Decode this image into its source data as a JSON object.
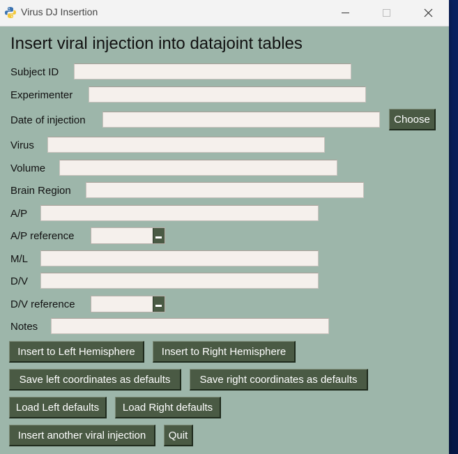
{
  "window": {
    "title": "Virus DJ Insertion",
    "controls": [
      "minimize",
      "maximize",
      "close"
    ]
  },
  "heading": "Insert viral injection into datajoint tables",
  "fields": {
    "subject_id": {
      "label": "Subject ID",
      "value": ""
    },
    "experimenter": {
      "label": "Experimenter",
      "value": ""
    },
    "date_of_injection": {
      "label": "Date of injection",
      "value": "",
      "button": "Choose"
    },
    "virus": {
      "label": "Virus",
      "value": ""
    },
    "volume": {
      "label": "Volume",
      "value": ""
    },
    "brain_region": {
      "label": "Brain Region",
      "value": ""
    },
    "ap": {
      "label": "A/P",
      "value": ""
    },
    "ap_reference": {
      "label": "A/P reference",
      "selected": ""
    },
    "ml": {
      "label": "M/L",
      "value": ""
    },
    "dv": {
      "label": "D/V",
      "value": ""
    },
    "dv_reference": {
      "label": "D/V reference",
      "selected": ""
    },
    "notes": {
      "label": "Notes",
      "value": ""
    }
  },
  "buttons": {
    "insert_left": "Insert to Left Hemisphere",
    "insert_right": "Insert to Right Hemisphere",
    "save_left": "Save left coordinates as defaults",
    "save_right": "Save right coordinates as defaults",
    "load_left": "Load Left defaults",
    "load_right": "Load Right defaults",
    "insert_another": "Insert another viral injection",
    "quit": "Quit"
  },
  "colors": {
    "window_bg": "#9db6aa",
    "button_bg": "#4a5a44",
    "input_bg": "#f5f0ec"
  }
}
